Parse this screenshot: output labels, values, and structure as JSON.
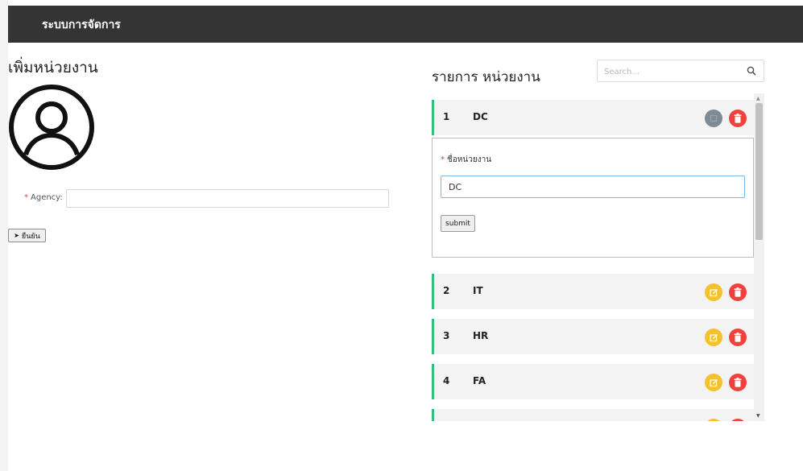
{
  "navbar": {
    "brand": "ระบบการจัดการ"
  },
  "form": {
    "title": "เพิ่มหน่วยงาน",
    "agency_label": "Agency:",
    "agency_value": "",
    "confirm_label": "ยืนยัน"
  },
  "list": {
    "title": "รายการ หน่วยงาน",
    "search_placeholder": "Search...",
    "rows": [
      {
        "num": "1",
        "name": "DC"
      },
      {
        "num": "2",
        "name": "IT"
      },
      {
        "num": "3",
        "name": "HR"
      },
      {
        "num": "4",
        "name": "FA"
      }
    ],
    "edit_form": {
      "field_label": "ชื่อหน่วยงาน",
      "field_value": "DC",
      "submit_label": "submit"
    }
  },
  "icons": {
    "avatar": "user-circle-icon",
    "search": "magnifier-icon",
    "edit": "pencil-square-icon",
    "delete": "trash-icon"
  },
  "colors": {
    "navbar": "#343434",
    "row_accent": "#2ec27e",
    "edit": "#f5c12e",
    "edit_disabled": "#7e8b96",
    "delete": "#f0413c",
    "required": "#e0403e"
  }
}
